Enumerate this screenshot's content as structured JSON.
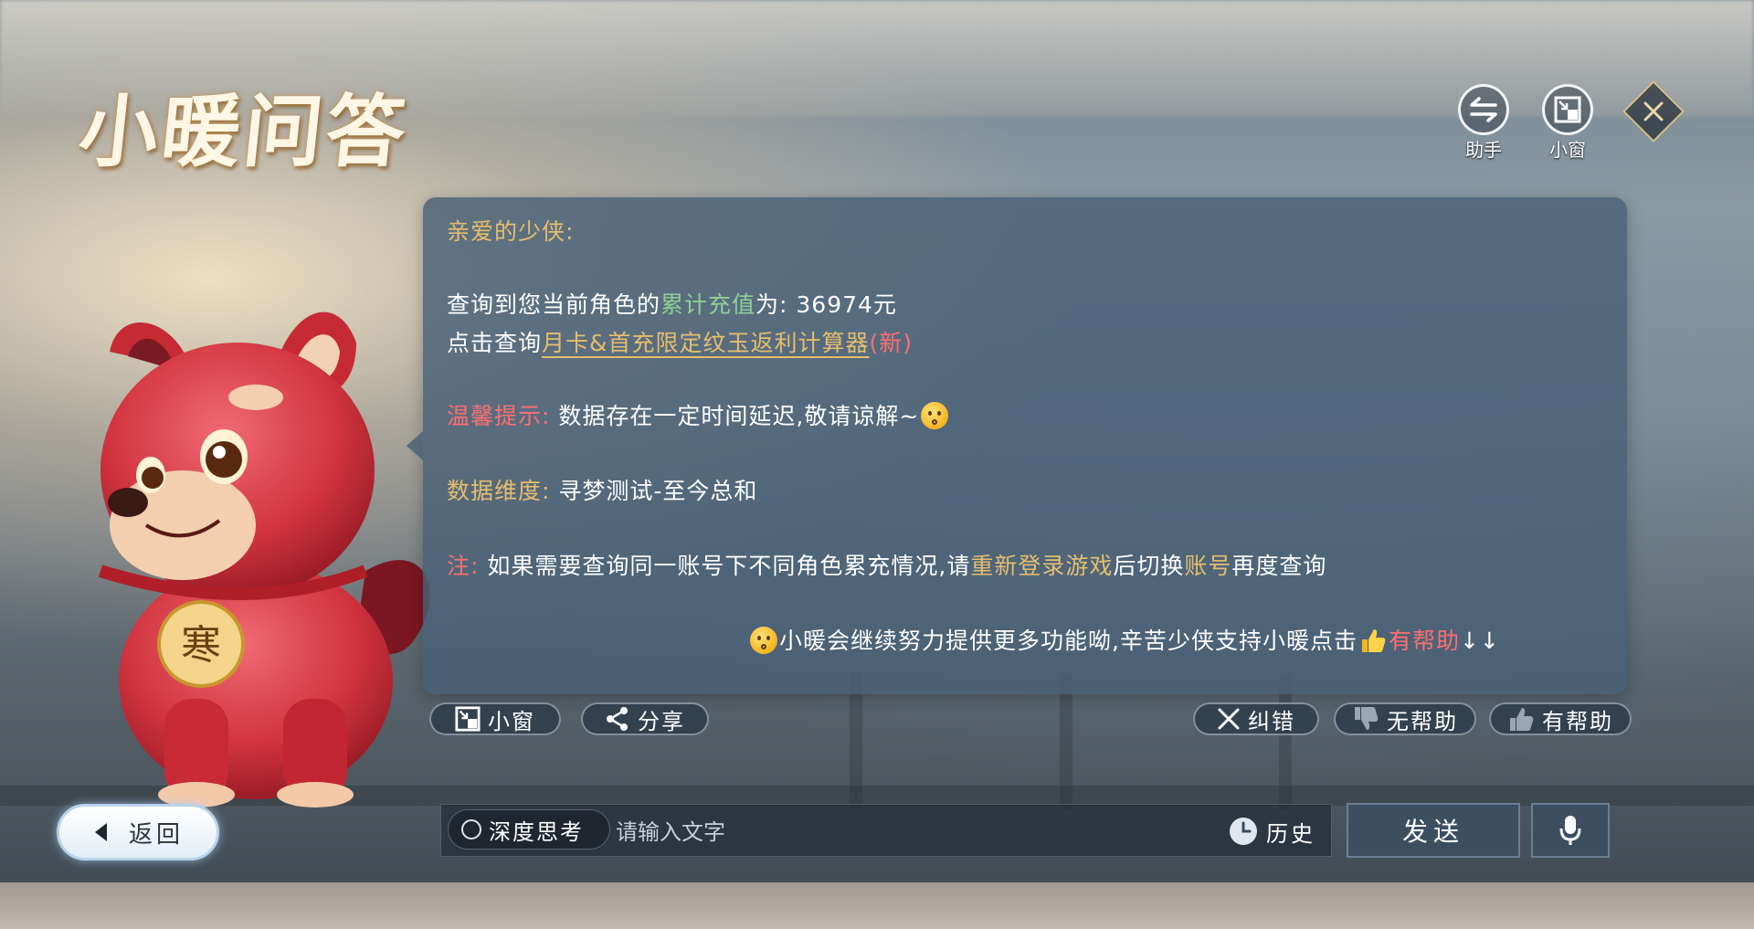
{
  "app": {
    "title": "小暖问答"
  },
  "top_buttons": {
    "assistant_label": "助手",
    "mini_window_label": "小窗"
  },
  "message": {
    "greeting": "亲爱的少侠:",
    "recharge_prefix": "查询到您当前角色的",
    "recharge_term": "累计充值",
    "recharge_suffix": "为: 36974元",
    "calc_prefix": "点击查询",
    "calc_link": "月卡&首充限定纹玉返利计算器",
    "calc_new": "(新)",
    "tip_label": "温馨提示:",
    "tip_text": " 数据存在一定时间延迟,敬请谅解~",
    "dimension_label": "数据维度:",
    "dimension_text": " 寻梦测试-至今总和",
    "note_label": "注:",
    "note_text1": " 如果需要查询同一账号下不同角色累充情况,请",
    "note_link1": "重新登录游戏",
    "note_text2": "后切换",
    "note_link2": "账号",
    "note_text3": "再度查询",
    "footer_text": "小暖会继续努力提供更多功能呦,辛苦少侠支持小暖点击",
    "footer_helpful": "有帮助",
    "footer_arrows": "↓↓"
  },
  "actions": {
    "mini_window": "小窗",
    "share": "分享",
    "correct": "纠错",
    "not_helpful": "无帮助",
    "helpful": "有帮助"
  },
  "bottom": {
    "back": "返回",
    "deep_think": "深度思考",
    "input_placeholder": "请输入文字",
    "history": "历史",
    "send": "发送"
  },
  "dog_tag_char": "寒",
  "colors": {
    "card_bg": "#48607a",
    "gold": "#e7bd6b",
    "green": "#8fcf95",
    "red": "#ff6f6f"
  }
}
